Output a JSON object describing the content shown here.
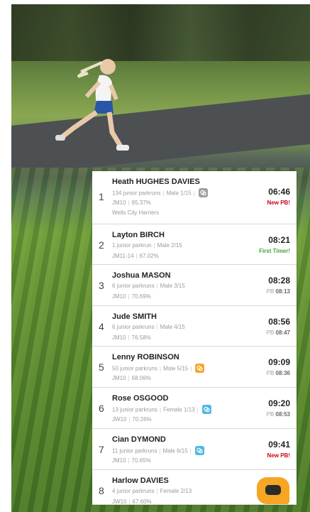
{
  "results": [
    {
      "position": "1",
      "name": "Heath HUGHES DAVIES",
      "runs": "134 junior parkruns",
      "gender_pos": "Male 1/15",
      "category": "JM10",
      "grade": "85.37%",
      "club": "Wells City Harriers",
      "time": "06:46",
      "note": "New PB!",
      "note_type": "new",
      "badge": "grey"
    },
    {
      "position": "2",
      "name": "Layton BIRCH",
      "runs": "1 junior parkrun",
      "gender_pos": "Male 2/15",
      "category": "JM11-14",
      "grade": "67.02%",
      "time": "08:21",
      "note": "First Timer!",
      "note_type": "first",
      "badge": ""
    },
    {
      "position": "3",
      "name": "Joshua MASON",
      "runs": "6 junior parkruns",
      "gender_pos": "Male 3/15",
      "category": "JM10",
      "grade": "70.69%",
      "time": "08:28",
      "note_label": "PB",
      "note_value": "08:13",
      "note_type": "pb",
      "badge": ""
    },
    {
      "position": "4",
      "name": "Jude SMITH",
      "runs": "6 junior parkruns",
      "gender_pos": "Male 4/15",
      "category": "JM10",
      "grade": "76.58%",
      "time": "08:56",
      "note_label": "PB",
      "note_value": "08:47",
      "note_type": "pb",
      "badge": ""
    },
    {
      "position": "5",
      "name": "Lenny ROBINSON",
      "runs": "50 junior parkruns",
      "gender_pos": "Male 5/15",
      "category": "JM10",
      "grade": "68.06%",
      "time": "09:09",
      "note_label": "PB",
      "note_value": "08:36",
      "note_type": "pb",
      "badge": "orange"
    },
    {
      "position": "6",
      "name": "Rose OSGOOD",
      "runs": "13 junior parkruns",
      "gender_pos": "Female 1/13",
      "category": "JW10",
      "grade": "70.26%",
      "time": "09:20",
      "note_label": "PB",
      "note_value": "08:53",
      "note_type": "pb",
      "badge": "blue"
    },
    {
      "position": "7",
      "name": "Cian DYMOND",
      "runs": "11 junior parkruns",
      "gender_pos": "Male 6/15",
      "category": "JM10",
      "grade": "70.65%",
      "time": "09:41",
      "note": "New PB!",
      "note_type": "new",
      "badge": "blue"
    },
    {
      "position": "8",
      "name": "Harlow DAVIES",
      "runs": "4 junior parkruns",
      "gender_pos": "Female 2/13",
      "category": "JW10",
      "grade": "67.60%",
      "time": "",
      "note": "",
      "note_type": "",
      "badge": ""
    }
  ],
  "colors": {
    "new_pb": "#d0021b",
    "first_timer": "#3fa535",
    "badge_grey": "#9e9e9e",
    "badge_orange": "#f6a623",
    "badge_blue": "#4fb7e3",
    "chat": "#f6a623"
  },
  "icons": {
    "badge": "milestone-badge-icon",
    "chat": "chat-icon"
  }
}
